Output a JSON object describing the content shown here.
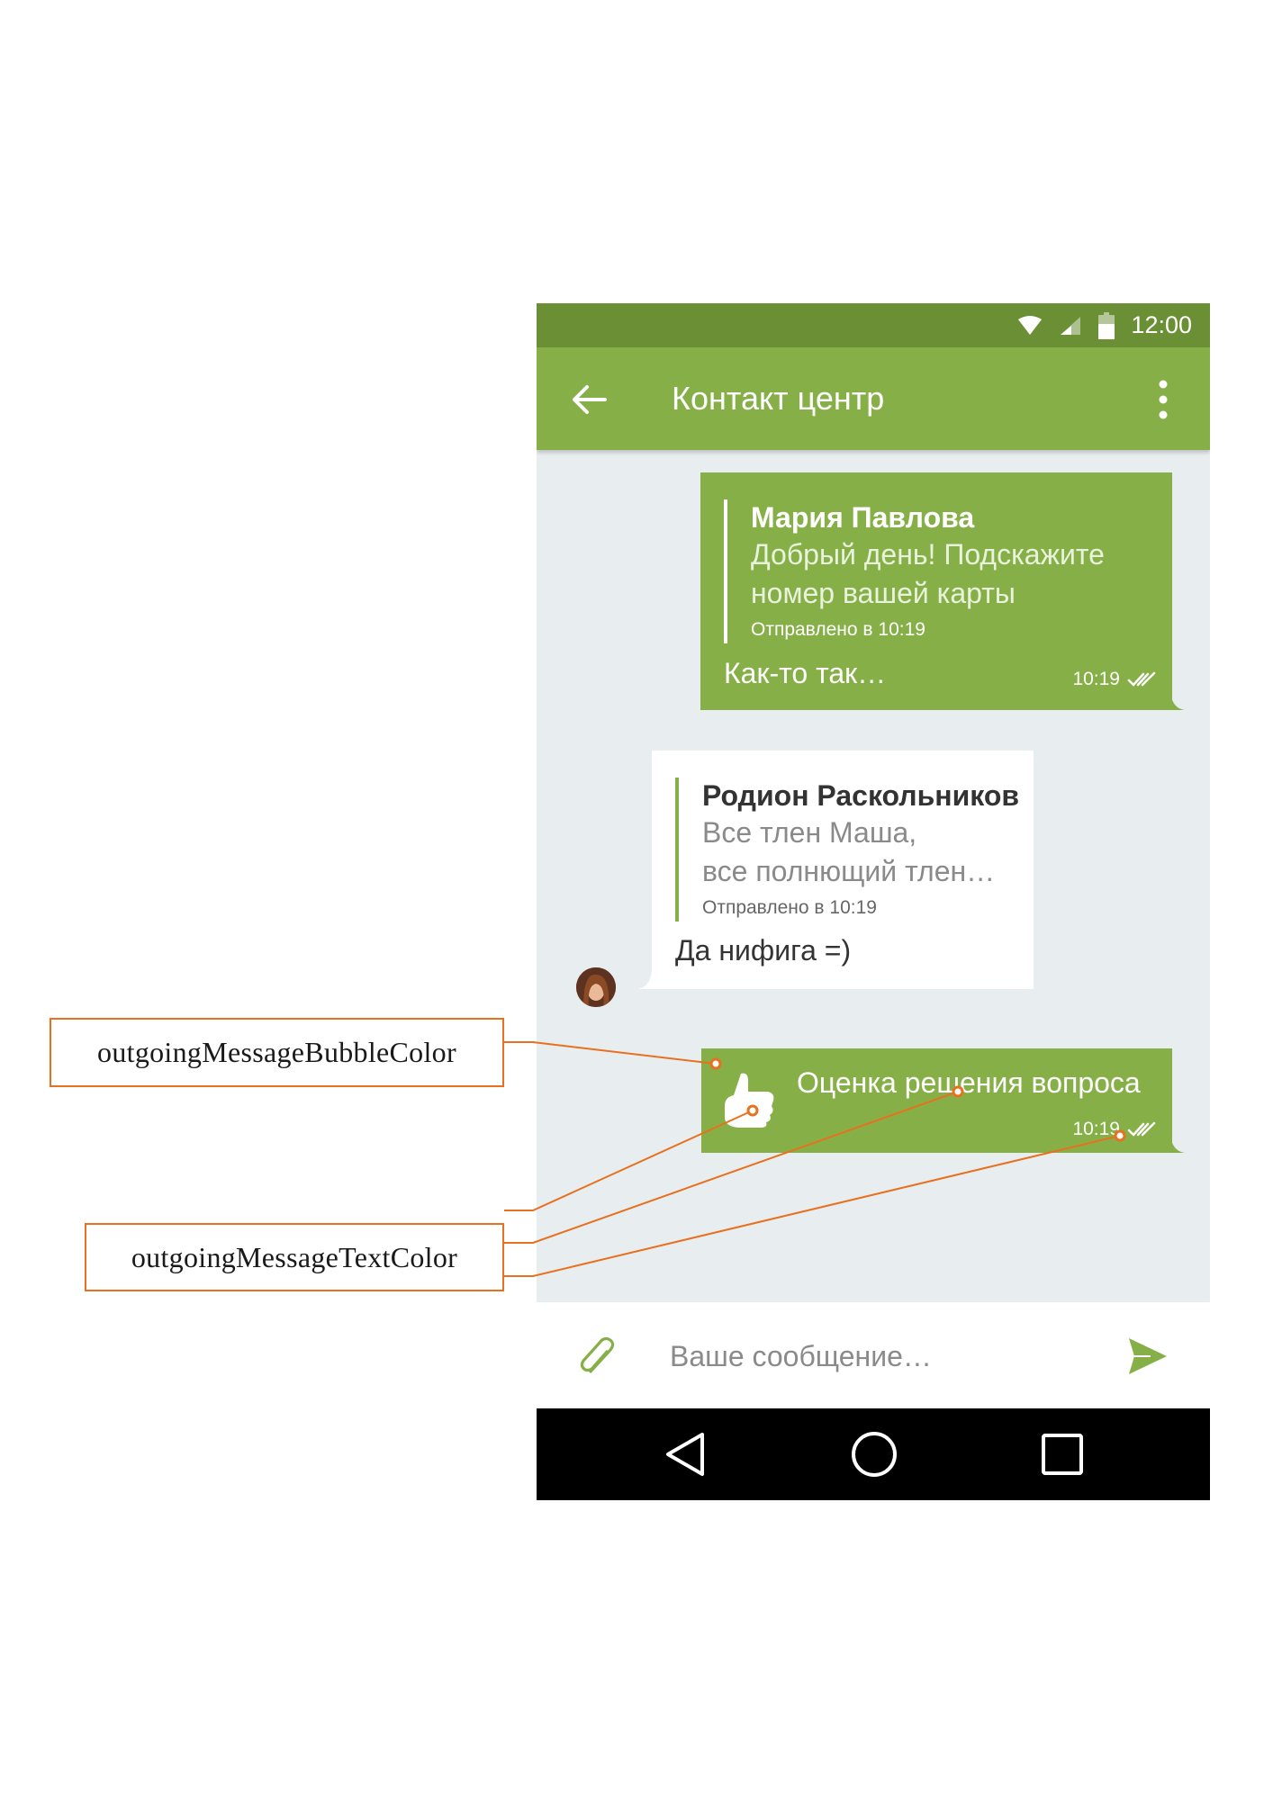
{
  "statusbar": {
    "time": "12:00"
  },
  "appbar": {
    "title": "Контакт центр"
  },
  "messages": {
    "m1": {
      "quote_name": "Мария Павлова",
      "quote_text": "Добрый день! Подскажите номер вашей карты",
      "quote_sent": "Отправлено в 10:19",
      "text": "Как-то так…",
      "time": "10:19"
    },
    "m2": {
      "quote_name": "Родион Раскольников",
      "quote_text_1": "Все тлен Маша,",
      "quote_text_2": "все полнющий тлен…",
      "quote_sent": "Отправлено в 10:19",
      "text": "Да нифига =)"
    },
    "m3": {
      "text": "Оценка решения вопроса",
      "time": "10:19"
    }
  },
  "input": {
    "placeholder": "Ваше сообщение…"
  },
  "annotations": {
    "bubble_color_label": "outgoingMessageBubbleColor",
    "text_color_label": "outgoingMessageTextColor"
  },
  "colors": {
    "status_bar": "#6a8f35",
    "app_bar": "#86b047",
    "outgoing_bubble": "#86b047",
    "incoming_bubble": "#ffffff",
    "chat_background": "#e8edef",
    "annotation": "#e8701e"
  },
  "icons": [
    "wifi-icon",
    "signal-icon",
    "battery-icon",
    "back-arrow-icon",
    "more-vert-icon",
    "double-check-icon",
    "thumbs-up-icon",
    "avatar",
    "paperclip-icon",
    "send-icon",
    "nav-back-icon",
    "nav-home-icon",
    "nav-recents-icon"
  ]
}
